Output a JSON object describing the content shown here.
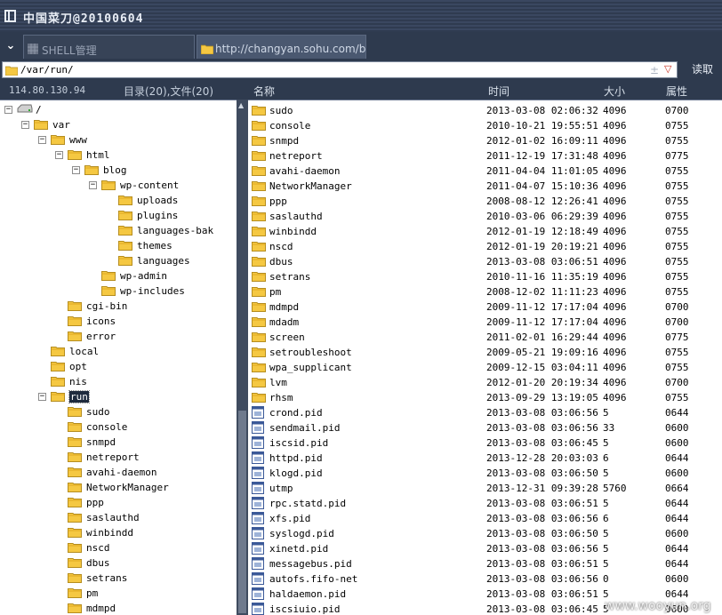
{
  "window": {
    "title": "中国菜刀@20100604"
  },
  "tabs": [
    {
      "label": "SHELL管理",
      "icon": "grid-icon"
    },
    {
      "label": "http://changyan.sohu.com/blog...",
      "icon": "folder-icon"
    }
  ],
  "address": {
    "path": "/var/run/",
    "bookmark_symbol": "±",
    "dropdown_symbol": "▽",
    "read_label": "读取"
  },
  "info": {
    "ip": "114.80.130.94",
    "counts": "目录(20),文件(20)"
  },
  "columns": {
    "name": "名称",
    "time": "时间",
    "size": "大小",
    "attr": "属性"
  },
  "colors": {
    "chrome_bg": "#2e3a4e",
    "selected_bg": "#1f2b3e",
    "folder": "#f5c842"
  },
  "tree": [
    {
      "label": "/",
      "icon": "drive-icon",
      "expander": "−"
    },
    {
      "label": "var",
      "icon": "folder-icon",
      "expander": "−"
    },
    {
      "label": "www",
      "icon": "folder-icon",
      "expander": "−"
    },
    {
      "label": "html",
      "icon": "folder-icon",
      "expander": "−"
    },
    {
      "label": "blog",
      "icon": "folder-icon",
      "expander": "−"
    },
    {
      "label": "wp-content",
      "icon": "folder-icon",
      "expander": "−"
    },
    {
      "label": "uploads",
      "icon": "folder-icon",
      "expander": ""
    },
    {
      "label": "plugins",
      "icon": "folder-icon",
      "expander": ""
    },
    {
      "label": "languages-bak",
      "icon": "folder-icon",
      "expander": ""
    },
    {
      "label": "themes",
      "icon": "folder-icon",
      "expander": ""
    },
    {
      "label": "languages",
      "icon": "folder-icon",
      "expander": ""
    },
    {
      "label": "wp-admin",
      "icon": "folder-icon",
      "expander": ""
    },
    {
      "label": "wp-includes",
      "icon": "folder-icon",
      "expander": ""
    },
    {
      "label": "cgi-bin",
      "icon": "folder-icon",
      "expander": ""
    },
    {
      "label": "icons",
      "icon": "folder-icon",
      "expander": ""
    },
    {
      "label": "error",
      "icon": "folder-icon",
      "expander": ""
    },
    {
      "label": "local",
      "icon": "folder-icon",
      "expander": ""
    },
    {
      "label": "opt",
      "icon": "folder-icon",
      "expander": ""
    },
    {
      "label": "nis",
      "icon": "folder-icon",
      "expander": ""
    },
    {
      "label": "run",
      "icon": "folder-icon",
      "expander": "−",
      "selected": true
    },
    {
      "label": "sudo",
      "icon": "folder-icon",
      "expander": ""
    },
    {
      "label": "console",
      "icon": "folder-icon",
      "expander": ""
    },
    {
      "label": "snmpd",
      "icon": "folder-icon",
      "expander": ""
    },
    {
      "label": "netreport",
      "icon": "folder-icon",
      "expander": ""
    },
    {
      "label": "avahi-daemon",
      "icon": "folder-icon",
      "expander": ""
    },
    {
      "label": "NetworkManager",
      "icon": "folder-icon",
      "expander": ""
    },
    {
      "label": "ppp",
      "icon": "folder-icon",
      "expander": ""
    },
    {
      "label": "saslauthd",
      "icon": "folder-icon",
      "expander": ""
    },
    {
      "label": "winbindd",
      "icon": "folder-icon",
      "expander": ""
    },
    {
      "label": "nscd",
      "icon": "folder-icon",
      "expander": ""
    },
    {
      "label": "dbus",
      "icon": "folder-icon",
      "expander": ""
    },
    {
      "label": "setrans",
      "icon": "folder-icon",
      "expander": ""
    },
    {
      "label": "pm",
      "icon": "folder-icon",
      "expander": ""
    },
    {
      "label": "mdmpd",
      "icon": "folder-icon",
      "expander": ""
    }
  ],
  "files": [
    {
      "name": "sudo",
      "type": "folder",
      "time": "2013-03-08 02:06:32",
      "size": "4096",
      "attr": "0700"
    },
    {
      "name": "console",
      "type": "folder",
      "time": "2010-10-21 19:55:51",
      "size": "4096",
      "attr": "0755"
    },
    {
      "name": "snmpd",
      "type": "folder",
      "time": "2012-01-02 16:09:11",
      "size": "4096",
      "attr": "0755"
    },
    {
      "name": "netreport",
      "type": "folder",
      "time": "2011-12-19 17:31:48",
      "size": "4096",
      "attr": "0775"
    },
    {
      "name": "avahi-daemon",
      "type": "folder",
      "time": "2011-04-04 11:01:05",
      "size": "4096",
      "attr": "0755"
    },
    {
      "name": "NetworkManager",
      "type": "folder",
      "time": "2011-04-07 15:10:36",
      "size": "4096",
      "attr": "0755"
    },
    {
      "name": "ppp",
      "type": "folder",
      "time": "2008-08-12 12:26:41",
      "size": "4096",
      "attr": "0755"
    },
    {
      "name": "saslauthd",
      "type": "folder",
      "time": "2010-03-06 06:29:39",
      "size": "4096",
      "attr": "0755"
    },
    {
      "name": "winbindd",
      "type": "folder",
      "time": "2012-01-19 12:18:49",
      "size": "4096",
      "attr": "0755"
    },
    {
      "name": "nscd",
      "type": "folder",
      "time": "2012-01-19 20:19:21",
      "size": "4096",
      "attr": "0755"
    },
    {
      "name": "dbus",
      "type": "folder",
      "time": "2013-03-08 03:06:51",
      "size": "4096",
      "attr": "0755"
    },
    {
      "name": "setrans",
      "type": "folder",
      "time": "2010-11-16 11:35:19",
      "size": "4096",
      "attr": "0755"
    },
    {
      "name": "pm",
      "type": "folder",
      "time": "2008-12-02 11:11:23",
      "size": "4096",
      "attr": "0755"
    },
    {
      "name": "mdmpd",
      "type": "folder",
      "time": "2009-11-12 17:17:04",
      "size": "4096",
      "attr": "0700"
    },
    {
      "name": "mdadm",
      "type": "folder",
      "time": "2009-11-12 17:17:04",
      "size": "4096",
      "attr": "0700"
    },
    {
      "name": "screen",
      "type": "folder",
      "time": "2011-02-01 16:29:44",
      "size": "4096",
      "attr": "0775"
    },
    {
      "name": "setroubleshoot",
      "type": "folder",
      "time": "2009-05-21 19:09:16",
      "size": "4096",
      "attr": "0755"
    },
    {
      "name": "wpa_supplicant",
      "type": "folder",
      "time": "2009-12-15 03:04:11",
      "size": "4096",
      "attr": "0755"
    },
    {
      "name": "lvm",
      "type": "folder",
      "time": "2012-01-20 20:19:34",
      "size": "4096",
      "attr": "0700"
    },
    {
      "name": "rhsm",
      "type": "folder",
      "time": "2013-09-29 13:19:05",
      "size": "4096",
      "attr": "0755"
    },
    {
      "name": "crond.pid",
      "type": "file",
      "time": "2013-03-08 03:06:56",
      "size": "5",
      "attr": "0644"
    },
    {
      "name": "sendmail.pid",
      "type": "file",
      "time": "2013-03-08 03:06:56",
      "size": "33",
      "attr": "0600"
    },
    {
      "name": "iscsid.pid",
      "type": "file",
      "time": "2013-03-08 03:06:45",
      "size": "5",
      "attr": "0600"
    },
    {
      "name": "httpd.pid",
      "type": "file",
      "time": "2013-12-28 20:03:03",
      "size": "6",
      "attr": "0644"
    },
    {
      "name": "klogd.pid",
      "type": "file",
      "time": "2013-03-08 03:06:50",
      "size": "5",
      "attr": "0600"
    },
    {
      "name": "utmp",
      "type": "file",
      "time": "2013-12-31 09:39:28",
      "size": "5760",
      "attr": "0664"
    },
    {
      "name": "rpc.statd.pid",
      "type": "file",
      "time": "2013-03-08 03:06:51",
      "size": "5",
      "attr": "0644"
    },
    {
      "name": "xfs.pid",
      "type": "file",
      "time": "2013-03-08 03:06:56",
      "size": "6",
      "attr": "0644"
    },
    {
      "name": "syslogd.pid",
      "type": "file",
      "time": "2013-03-08 03:06:50",
      "size": "5",
      "attr": "0600"
    },
    {
      "name": "xinetd.pid",
      "type": "file",
      "time": "2013-03-08 03:06:56",
      "size": "5",
      "attr": "0644"
    },
    {
      "name": "messagebus.pid",
      "type": "file",
      "time": "2013-03-08 03:06:51",
      "size": "5",
      "attr": "0644"
    },
    {
      "name": "autofs.fifo-net",
      "type": "file",
      "time": "2013-03-08 03:06:56",
      "size": "0",
      "attr": "0600"
    },
    {
      "name": "haldaemon.pid",
      "type": "file",
      "time": "2013-03-08 03:06:51",
      "size": "5",
      "attr": "0644"
    },
    {
      "name": "iscsiuio.pid",
      "type": "file",
      "time": "2013-03-08 03:06:45",
      "size": "5",
      "attr": "0600"
    }
  ],
  "watermark": "www.wooyun.org"
}
